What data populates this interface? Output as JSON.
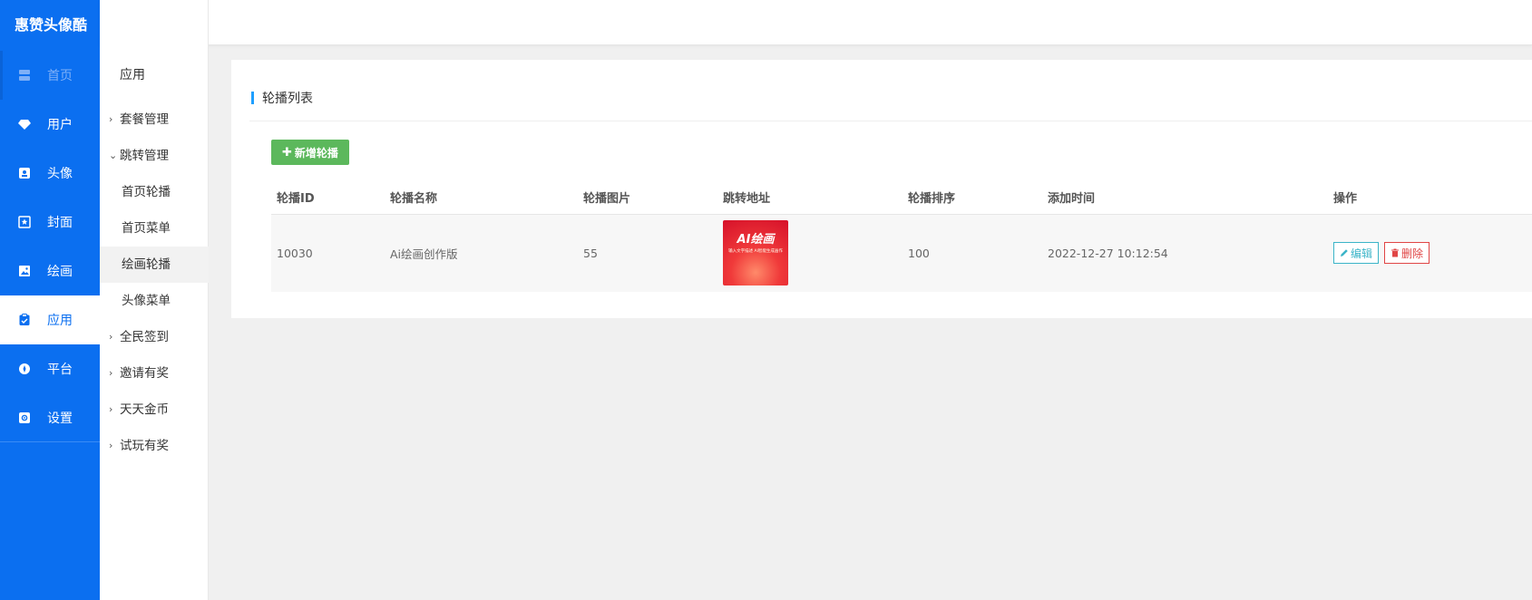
{
  "brand": "惠赞头像酷",
  "nav": [
    {
      "label": "首页",
      "icon": "server-icon"
    },
    {
      "label": "用户",
      "icon": "diamond-icon"
    },
    {
      "label": "头像",
      "icon": "portrait-icon"
    },
    {
      "label": "封面",
      "icon": "star-frame-icon"
    },
    {
      "label": "绘画",
      "icon": "image-icon"
    },
    {
      "label": "应用",
      "icon": "clipboard-icon"
    },
    {
      "label": "平台",
      "icon": "compass-icon"
    },
    {
      "label": "设置",
      "icon": "gear-icon"
    }
  ],
  "submenu": {
    "title": "应用",
    "items": [
      {
        "label": "套餐管理",
        "arrow": "›"
      },
      {
        "label": "跳转管理",
        "arrow": "⌄"
      },
      {
        "label": "首页轮播"
      },
      {
        "label": "首页菜单"
      },
      {
        "label": "绘画轮播"
      },
      {
        "label": "头像菜单"
      },
      {
        "label": "全民签到",
        "arrow": "›"
      },
      {
        "label": "邀请有奖",
        "arrow": "›"
      },
      {
        "label": "天天金币",
        "arrow": "›"
      },
      {
        "label": "试玩有奖",
        "arrow": "›"
      }
    ]
  },
  "panel": {
    "title": "轮播列表",
    "add_label": "新增轮播"
  },
  "table": {
    "headers": [
      "轮播ID",
      "轮播名称",
      "轮播图片",
      "跳转地址",
      "轮播排序",
      "添加时间",
      "操作"
    ],
    "rows": [
      {
        "id": "10030",
        "name": "Ai绘画创作版",
        "image_value": "55",
        "thumb_title": "AI绘画",
        "thumb_caption": "输入文字描述 AI智能生成画作",
        "sort": "100",
        "time": "2022-12-27 10:12:54",
        "edit_label": "编辑",
        "delete_label": "删除"
      }
    ]
  },
  "colors": {
    "sidebar": "#0b6ff0",
    "add_button": "#5cb85c",
    "edit": "#3bb4c8",
    "delete": "#e04545",
    "title_bar": "#1e9fff"
  }
}
